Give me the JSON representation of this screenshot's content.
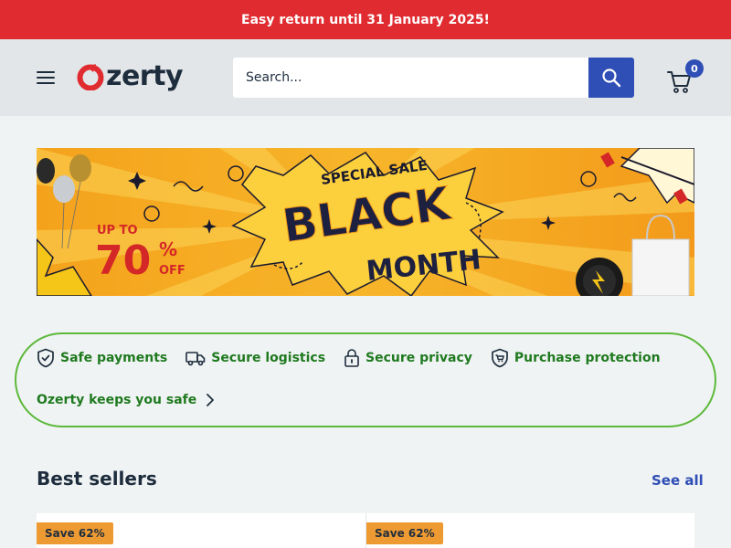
{
  "announcement": {
    "text": "Easy return until 31 January 2025!"
  },
  "header": {
    "logo_text": "zerty",
    "logo_brand_color": "#e02b30",
    "search_placeholder": "Search...",
    "cart_count": "0",
    "accent_color": "#2f4eb6"
  },
  "banner": {
    "line1": "SPECIAL SALE",
    "line2": "BLACK",
    "line3": "MONTH",
    "promo_prefix": "UP TO",
    "promo_value": "70",
    "promo_percent": "%",
    "promo_suffix": "OFF"
  },
  "trust": {
    "items": [
      {
        "label": "Safe payments",
        "icon": "shield-check-icon"
      },
      {
        "label": "Secure logistics",
        "icon": "truck-icon"
      },
      {
        "label": "Secure privacy",
        "icon": "lock-icon"
      },
      {
        "label": "Purchase protection",
        "icon": "shield-cart-icon"
      }
    ],
    "link_label": "Ozerty keeps you safe",
    "color": "#1f7a1f"
  },
  "best_sellers": {
    "title": "Best sellers",
    "see_all": "See all",
    "products": [
      {
        "badge": "Save 62%"
      },
      {
        "badge": "Save 62%"
      }
    ]
  }
}
